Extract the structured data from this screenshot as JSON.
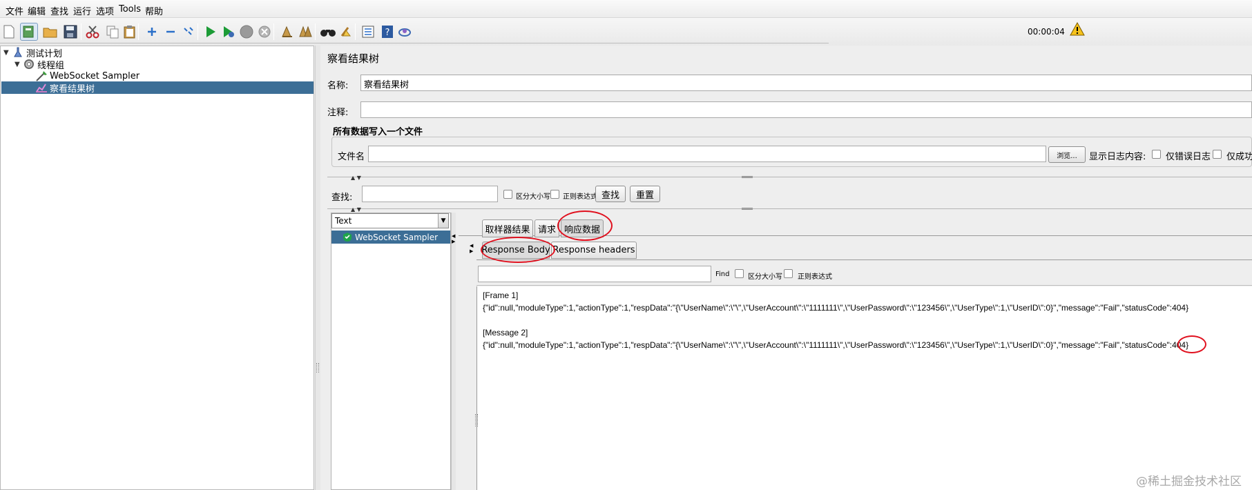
{
  "menubar": {
    "items": [
      "文件",
      "编辑",
      "查找",
      "运行",
      "选项",
      "Tools",
      "帮助"
    ]
  },
  "toolbar": {
    "timer": "00:00:04",
    "icons": [
      "new-icon",
      "templates-icon",
      "open-icon",
      "save-icon",
      "cut-icon",
      "copy-icon",
      "paste-icon",
      "expand-icon",
      "collapse-icon",
      "toggle-icon",
      "start-icon",
      "start-no-pause-icon",
      "stop-icon",
      "shutdown-icon",
      "clear-icon",
      "clear-all-icon",
      "search-icon",
      "reset-search-icon",
      "function-helper-icon",
      "help-icon",
      "remote-icon",
      "warning-icon"
    ]
  },
  "tree": {
    "items": [
      {
        "label": "测试计划",
        "icon": "test-plan-icon"
      },
      {
        "label": "线程组",
        "icon": "thread-group-icon"
      },
      {
        "label": "WebSocket Sampler",
        "icon": "sampler-icon"
      },
      {
        "label": "察看结果树",
        "icon": "listener-icon"
      }
    ]
  },
  "panel": {
    "title": "察看结果树",
    "name_label": "名称:",
    "name_value": "察看结果树",
    "comment_label": "注释:",
    "comment_value": "",
    "file_section_title": "所有数据写入一个文件",
    "filename_label": "文件名",
    "filename_value": "",
    "browse_button": "浏览...",
    "log_content_label": "显示日志内容:",
    "errors_only_label": "仅错误日志",
    "success_only_label": "仅成功"
  },
  "search": {
    "label": "查找:",
    "value": "",
    "case_sensitive_label": "区分大小写",
    "regex_label": "正则表达式",
    "find_button": "查找",
    "reset_button": "重置"
  },
  "results": {
    "renderer_selected": "Text",
    "samples": [
      {
        "label": "WebSocket Sampler",
        "status": "success"
      }
    ],
    "tabs": [
      "取样器结果",
      "请求",
      "响应数据"
    ],
    "active_tab": "响应数据",
    "subtabs": [
      "Response Body",
      "Response headers"
    ],
    "active_subtab": "Response Body",
    "find_label": "Find",
    "find_value": "",
    "find_case_label": "区分大小写",
    "find_regex_label": "正则表达式",
    "body_lines": [
      "[Frame 1]",
      "{\"id\":null,\"moduleType\":1,\"actionType\":1,\"respData\":\"{\\\"UserName\\\":\\\"\\\",\\\"UserAccount\\\":\\\"1111111\\\",\\\"UserPassword\\\":\\\"123456\\\",\\\"UserType\\\":1,\\\"UserID\\\":0}\",\"message\":\"Fail\",\"statusCode\":404}",
      "",
      "[Message 2]",
      "{\"id\":null,\"moduleType\":1,\"actionType\":1,\"respData\":\"{\\\"UserName\\\":\\\"\\\",\\\"UserAccount\\\":\\\"1111111\\\",\\\"UserPassword\\\":\\\"123456\\\",\\\"UserType\\\":1,\\\"UserID\\\":0}\",\"message\":\"Fail\",\"statusCode\":404}"
    ]
  },
  "watermark": "@稀土掘金技术社区",
  "colors": {
    "selection": "#3c6e96",
    "annotation": "#e0101e",
    "success": "#1fa54a"
  }
}
